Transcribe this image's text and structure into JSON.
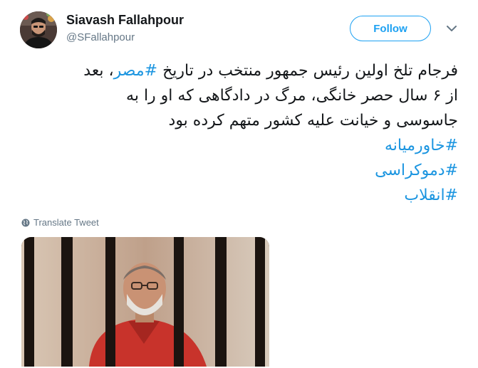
{
  "author": {
    "display_name": "Siavash Fallahpour",
    "handle": "@SFallahpour"
  },
  "follow_button": {
    "label": "Follow"
  },
  "tweet": {
    "line1_pre": "فرجام تلخ اولین رئیس جمهور منتخب در تاریخ ",
    "line1_tag": "#مصر",
    "line1_post": "، بعد",
    "line2": "از ۶ سال حصر خانگی، مرگ در دادگاهی که او را به",
    "line3": "جاسوسی و خیانت علیه کشور متهم کرده بود",
    "hashtags": [
      "#خاورمیانه",
      "#دموکراسی",
      "#انقلاب"
    ]
  },
  "translate_link": {
    "label": "Translate Tweet"
  },
  "colors": {
    "accent": "#1da1f2",
    "hashtag": "#1b95e0",
    "muted": "#657786",
    "text": "#14171a"
  },
  "icons": {
    "caret": "chevron-down-icon",
    "translate": "globe-icon"
  }
}
